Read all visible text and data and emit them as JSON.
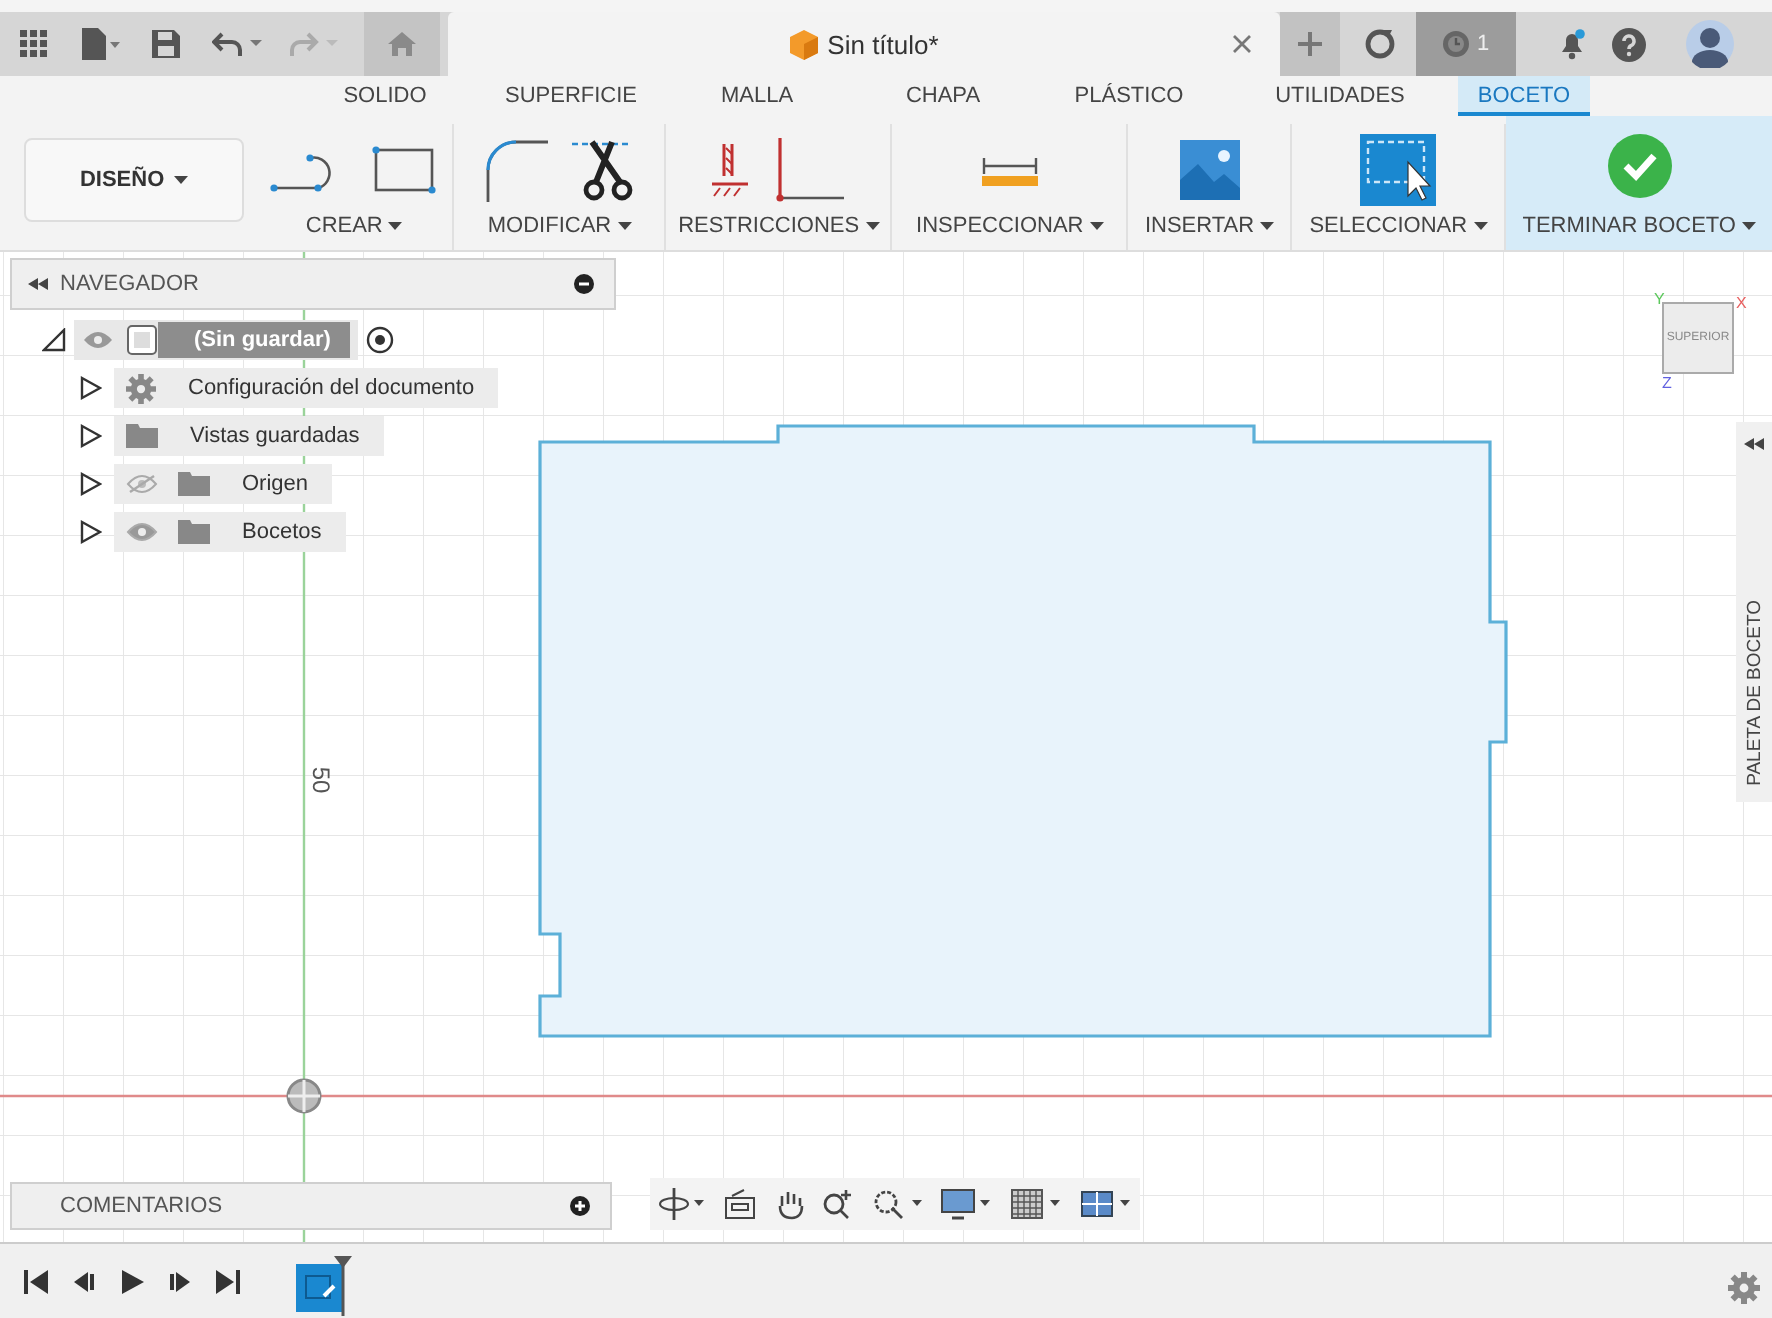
{
  "app_bar": {
    "notification_count": "1"
  },
  "document_tab": {
    "title": "Sin título*"
  },
  "ribbon_tabs": [
    {
      "label": "SOLIDO",
      "selected": false
    },
    {
      "label": "SUPERFICIE",
      "selected": false
    },
    {
      "label": "MALLA",
      "selected": false
    },
    {
      "label": "CHAPA",
      "selected": false
    },
    {
      "label": "PLÁSTICO",
      "selected": false
    },
    {
      "label": "UTILIDADES",
      "selected": false
    },
    {
      "label": "BOCETO",
      "selected": true
    }
  ],
  "workspace": {
    "label": "DISEÑO"
  },
  "tool_groups": [
    {
      "label": "CREAR",
      "kind": "create",
      "highlighted": false
    },
    {
      "label": "MODIFICAR",
      "kind": "modify",
      "highlighted": false
    },
    {
      "label": "RESTRICCIONES",
      "kind": "constraints",
      "highlighted": false
    },
    {
      "label": "INSPECCIONAR",
      "kind": "inspect",
      "highlighted": false
    },
    {
      "label": "INSERTAR",
      "kind": "insert",
      "highlighted": false
    },
    {
      "label": "SELECCIONAR",
      "kind": "select",
      "highlighted": false
    },
    {
      "label": "TERMINAR BOCETO",
      "kind": "finish",
      "highlighted": true
    }
  ],
  "navigator": {
    "title": "NAVEGADOR",
    "root": {
      "label": "(Sin guardar)",
      "selected": true,
      "expanded": true,
      "visible": true,
      "children": [
        {
          "label": "Configuración del documento",
          "kind": "settings",
          "selected": false,
          "expanded": false
        },
        {
          "label": "Vistas guardadas",
          "kind": "folder",
          "selected": false,
          "expanded": false
        },
        {
          "label": "Origen",
          "kind": "folder",
          "selected": false,
          "expanded": false,
          "visible": false
        },
        {
          "label": "Bocetos",
          "kind": "folder",
          "selected": false,
          "expanded": false,
          "visible": true
        }
      ]
    }
  },
  "viewcube": {
    "face": "SUPERIOR",
    "axes": [
      {
        "label": "Y",
        "color": "#5cc85c"
      },
      {
        "label": "X",
        "color": "#e86060"
      },
      {
        "label": "Z",
        "color": "#6060e0"
      }
    ]
  },
  "sketch": {
    "dimension": "50"
  },
  "palette": {
    "title": "PALETA DE BOCETO"
  },
  "comments": {
    "title": "COMENTARIOS"
  }
}
